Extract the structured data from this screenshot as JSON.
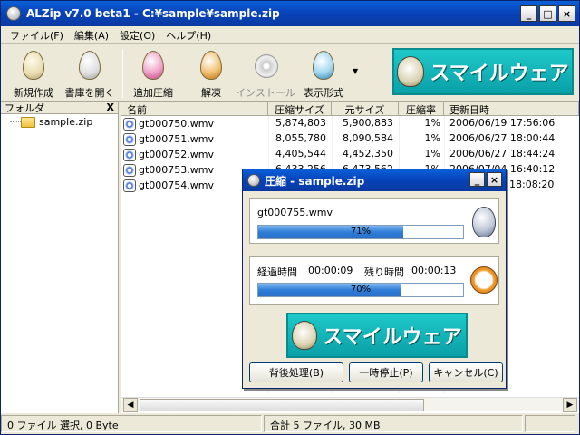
{
  "window": {
    "title": "ALZip v7.0 beta1 - C:¥sample¥sample.zip"
  },
  "menu": [
    "ファイル(F)",
    "編集(A)",
    "設定(O)",
    "ヘルプ(H)"
  ],
  "toolbar": {
    "items": [
      {
        "label": "新規作成",
        "icon": "new-archive-icon",
        "enabled": true
      },
      {
        "label": "書庫を開く",
        "icon": "open-archive-icon",
        "enabled": true
      },
      {
        "label": "追加圧縮",
        "icon": "add-compress-icon",
        "enabled": true
      },
      {
        "label": "解凍",
        "icon": "extract-icon",
        "enabled": true
      },
      {
        "label": "インストール",
        "icon": "install-icon",
        "enabled": false
      },
      {
        "label": "表示形式",
        "icon": "view-mode-icon",
        "enabled": true
      }
    ],
    "banner_text": "スマイルウェア"
  },
  "folder_pane": {
    "header": "フォルダ",
    "close": "X",
    "item": "sample.zip"
  },
  "file_list": {
    "columns": [
      "名前",
      "圧縮サイズ",
      "元サイズ",
      "圧縮率",
      "更新日時"
    ],
    "rows": [
      {
        "name": "gt000750.wmv",
        "compressed": "5,874,803",
        "original": "5,900,883",
        "ratio": "1%",
        "modified": "2006/06/19 17:56:06"
      },
      {
        "name": "gt000751.wmv",
        "compressed": "8,055,780",
        "original": "8,090,584",
        "ratio": "1%",
        "modified": "2006/06/27 18:00:44"
      },
      {
        "name": "gt000752.wmv",
        "compressed": "4,405,544",
        "original": "4,452,350",
        "ratio": "1%",
        "modified": "2006/06/27 18:44:24"
      },
      {
        "name": "gt000753.wmv",
        "compressed": "6,433,256",
        "original": "6,473,562",
        "ratio": "1%",
        "modified": "2006/07/04 16:40:12"
      },
      {
        "name": "gt000754.wmv",
        "compressed": "",
        "original": "",
        "ratio": "",
        "modified": "18:08:20"
      }
    ]
  },
  "status": {
    "left": "0 ファイル 選択, 0 Byte",
    "right": "合計 5 ファイル, 30 MB"
  },
  "dialog": {
    "title": "圧縮 - sample.zip",
    "file": "gt000755.wmv",
    "file_progress": 71,
    "file_progress_text": "71%",
    "elapsed_label": "経過時間",
    "elapsed": "00:00:09",
    "remaining_label": "残り時間",
    "remaining": "00:00:13",
    "total_progress": 70,
    "total_progress_text": "70%",
    "banner_text": "スマイルウェア",
    "buttons": [
      "背後処理(B)",
      "一時停止(P)",
      "キャンセル(C)"
    ]
  },
  "colors": {
    "titlebar": "#0842b8",
    "progress": "#2f7ed8",
    "banner": "#1ec8c8"
  }
}
